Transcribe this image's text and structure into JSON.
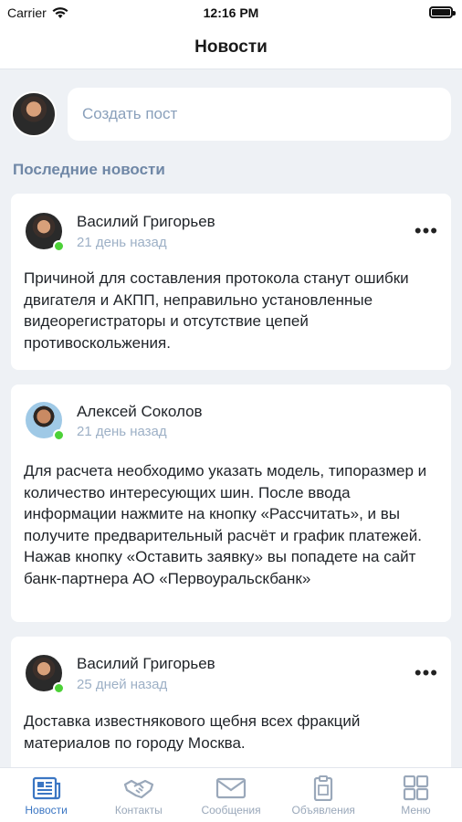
{
  "status_bar": {
    "carrier": "Carrier",
    "time": "12:16 PM"
  },
  "header": {
    "title": "Новости"
  },
  "composer": {
    "placeholder": "Создать пост"
  },
  "feed": {
    "section_title": "Последние новости",
    "posts": [
      {
        "author": "Василий Григорьев",
        "date": "21 день назад",
        "more": "•••",
        "text": "Причиной для составления протокола станут ошибки двигателя и АКПП, неправильно установленные видеорегистраторы и отсутствие цепей противоскольжения."
      },
      {
        "author": "Алексей Соколов",
        "date": "21 день назад",
        "more": "",
        "text": "Для расчета необходимо указать модель, типоразмер и количество интересующих шин. После ввода информации нажмите на кнопку «Рассчитать», и вы получите предварительный расчёт и график платежей. Нажав кнопку «Оставить заявку» вы попадете на сайт банк-партнера АО «Первоуральскбанк»"
      },
      {
        "author": "Василий Григорьев",
        "date": "25 дней назад",
        "more": "•••",
        "text": "Доставка известнякового щебня всех фракций материалов по городу Москва."
      }
    ]
  },
  "tabs": [
    {
      "label": "Новости",
      "icon": "newspaper-icon",
      "active": true
    },
    {
      "label": "Контакты",
      "icon": "handshake-icon",
      "active": false
    },
    {
      "label": "Сообщения",
      "icon": "envelope-icon",
      "active": false
    },
    {
      "label": "Объявления",
      "icon": "clipboard-icon",
      "active": false
    },
    {
      "label": "Меню",
      "icon": "grid-icon",
      "active": false
    }
  ],
  "colors": {
    "accent": "#3b76c3",
    "online": "#4cd137",
    "muted": "#9db0c6",
    "section": "#6f87a6"
  }
}
